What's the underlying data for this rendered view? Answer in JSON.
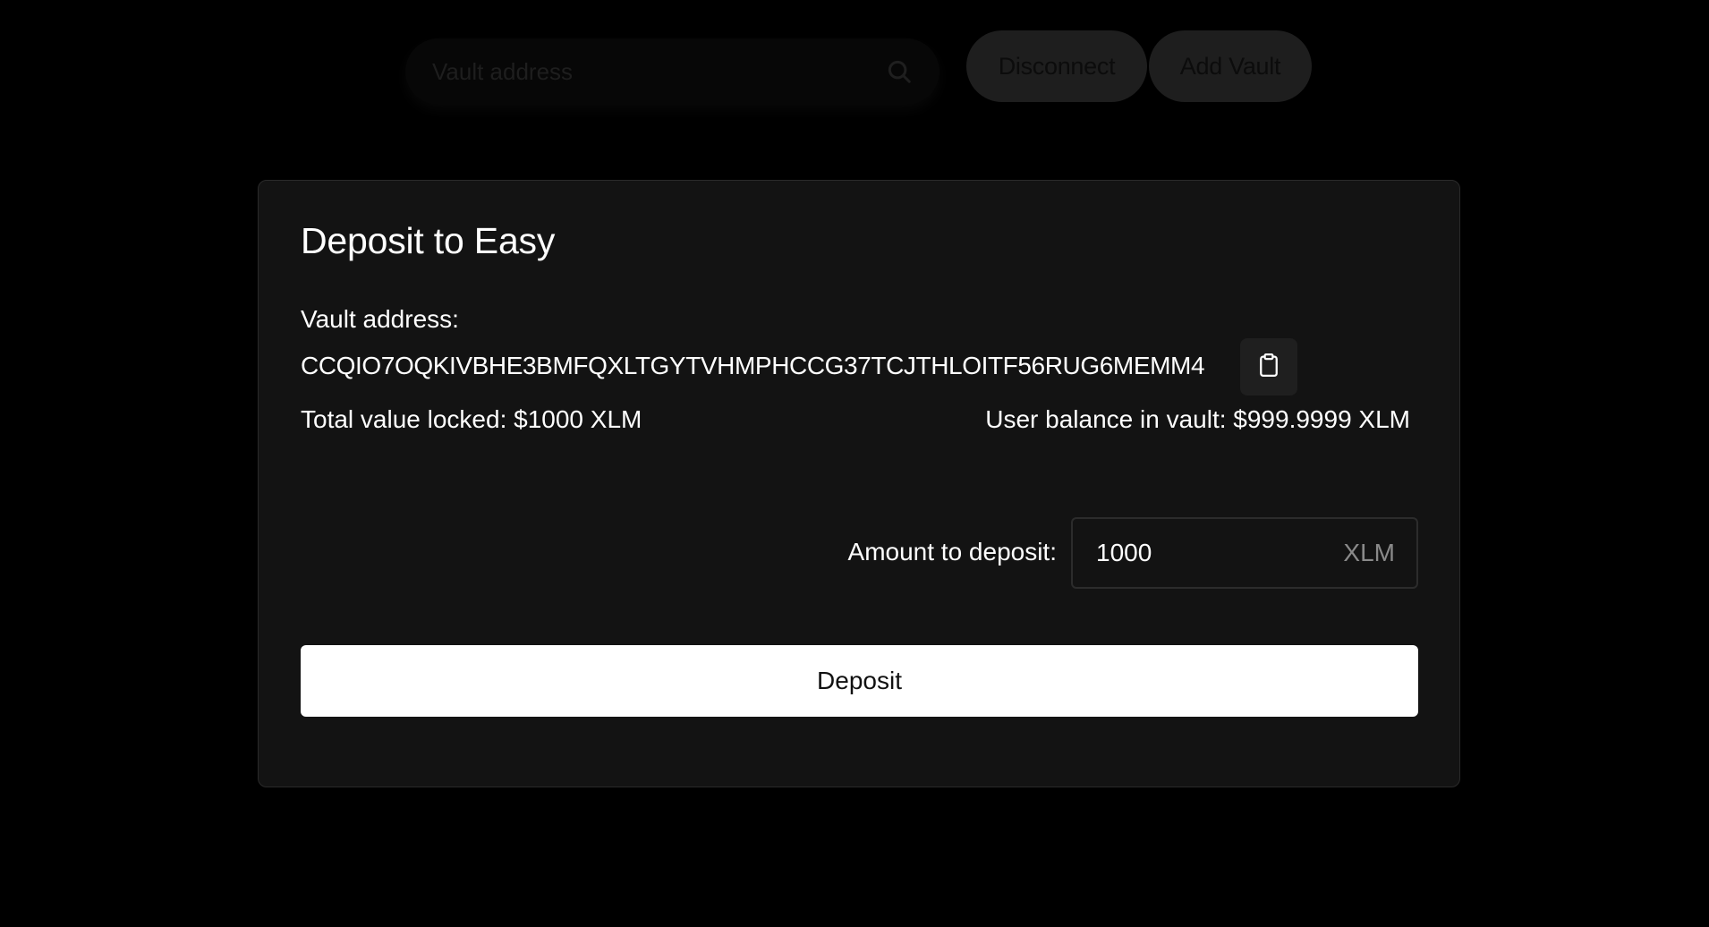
{
  "header": {
    "search": {
      "placeholder": "Vault address",
      "value": ""
    },
    "disconnect_label": "Disconnect",
    "add_vault_label": "Add Vault"
  },
  "modal": {
    "title": "Deposit to Easy",
    "vault_address_label": "Vault address:",
    "vault_address": "CCQIO7OQKIVBHE3BMFQXLTGYTVHMPHCCG37TCJTHLOITF56RUG6MEMM4",
    "total_value_locked": "Total value locked: $1000 XLM",
    "user_balance": "User balance in vault: $999.9999 XLM",
    "amount_label": "Amount to deposit:",
    "amount_value": "1000",
    "amount_unit": "XLM",
    "deposit_label": "Deposit"
  },
  "icons": {
    "search": "search-icon",
    "copy": "clipboard-icon"
  },
  "colors": {
    "background": "#000000",
    "modal_bg": "#131313",
    "primary_button_bg": "#ffffff",
    "primary_button_text": "#111111",
    "unit_text": "#8a8a8a"
  }
}
